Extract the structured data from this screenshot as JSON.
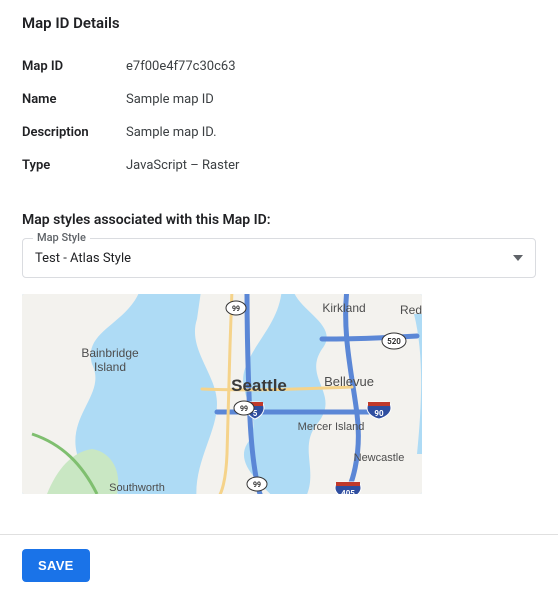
{
  "details": {
    "section_title": "Map ID Details",
    "rows": {
      "map_id": {
        "label": "Map ID",
        "value": "e7f00e4f77c30c63"
      },
      "name": {
        "label": "Name",
        "value": "Sample map ID"
      },
      "description": {
        "label": "Description",
        "value": "Sample map ID."
      },
      "type": {
        "label": "Type",
        "value": "JavaScript – Raster"
      }
    }
  },
  "styles": {
    "heading": "Map styles associated with this Map ID:",
    "select_label": "Map Style",
    "selected_value": "Test - Atlas Style"
  },
  "map_preview": {
    "center_label": "Seattle",
    "labels": {
      "kirkland": "Kirkland",
      "redmond": "Redmond",
      "bellevue": "Bellevue",
      "mercer": "Mercer Island",
      "newcastle": "Newcastle",
      "bainbridge1": "Bainbridge",
      "bainbridge2": "Island",
      "southworth": "Southworth"
    },
    "shields": {
      "i5": "5",
      "i405": "405",
      "i90": "90",
      "sr99a": "99",
      "sr99b": "99",
      "sr99c": "99",
      "sr520": "520"
    }
  },
  "footer": {
    "save_label": "SAVE"
  }
}
